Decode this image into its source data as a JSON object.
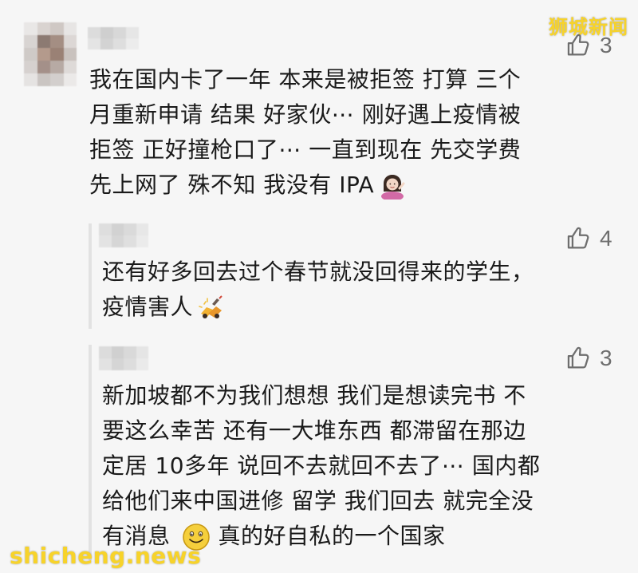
{
  "watermark": {
    "top": "狮城新闻",
    "bottom": "shicheng.news"
  },
  "colors": {
    "background": "#f6f6f6",
    "text": "#1a1a1a",
    "muted": "#6e6e6e",
    "watermark": "#f7d32a",
    "reply_bar": "#e2e2e2"
  },
  "main_comment": {
    "author_blurred": true,
    "likes": "3",
    "lines": [
      "我在国内卡了一年  本来是被拒签  打算  三个",
      "月重新申请  结果  好家伙⋯  刚好遇上疫情被",
      "拒签  正好撞枪口了⋯  一直到现在  先交学费",
      "先上网了  殊不知  我没有  IPA"
    ],
    "trailing_emoji": "person-shrugging-emoji"
  },
  "replies": [
    {
      "author_blurred": true,
      "likes": "4",
      "lines": [
        "还有好多回去过个春节就没回得来的学生，",
        "疫情害人"
      ],
      "trailing_emoji": "bomb-emoji"
    },
    {
      "author_blurred": true,
      "likes": "3",
      "lines": [
        "新加坡都不为我们想想  我们是想读完书  不",
        "要这么幸苦   还有一大堆东西  都滞留在那边",
        "定居  10多年  说回不去就回不去了⋯  国内都",
        "给他们来中国进修  留学  我们回去  就完全没",
        "有消息",
        "真的好自私的一个国家"
      ],
      "inline_emoji": "smiley-emoji"
    }
  ]
}
